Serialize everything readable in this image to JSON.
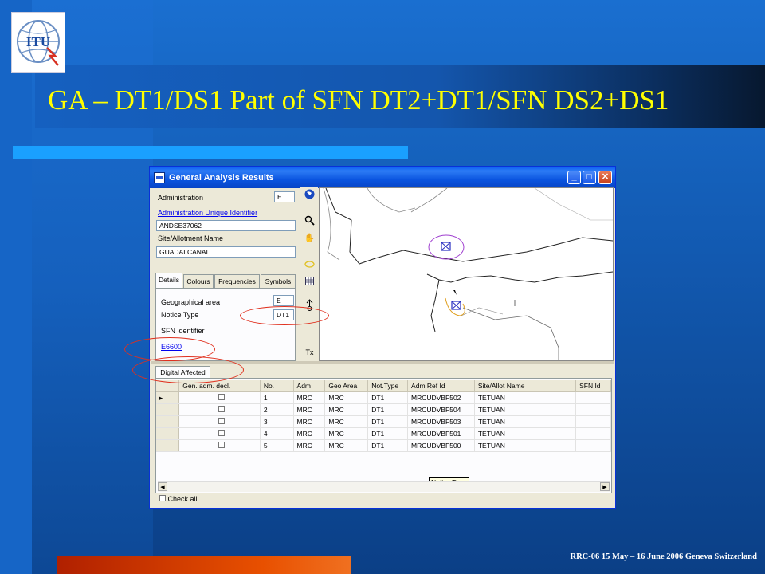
{
  "slide": {
    "title": "GA – DT1/DS1 Part of SFN DT2+DT1/SFN DS2+DS1",
    "footer": "RRC-06 15 May – 16 June 2006 Geneva Switzerland",
    "logo_text": "ITU",
    "colors": {
      "title": "#ffff00",
      "background": "#1259b0",
      "accent_line": "#1aa0ff",
      "bottom_bar": "#e85000"
    }
  },
  "window": {
    "title": "General Analysis Results",
    "fields": {
      "administration_label": "Administration",
      "administration_value": "E",
      "admin_uid_link": "Administration Unique Identifier",
      "admin_uid_value": "ANDSE37062",
      "site_label": "Site/Allotment Name",
      "site_value": "GUADALCANAL"
    },
    "tabs": [
      "Details",
      "Colours",
      "Frequencies",
      "Symbols"
    ],
    "details": {
      "geo_label": "Geographical area",
      "geo_value": "E",
      "notice_label": "Notice Type",
      "notice_value": "DT1",
      "sfn_label": "SFN identifier",
      "sfn_link": "E6600"
    },
    "tools": [
      "globe-icon",
      "zoom-icon",
      "hand-icon",
      "ellipse-icon",
      "grid-icon",
      "arrow-icon"
    ],
    "tool_tx": "Tx",
    "lower_tab": "Digital Affected",
    "grid": {
      "columns": [
        "Gen. adm. decl.",
        "No.",
        "Adm",
        "Geo Area",
        "Not.Type",
        "Adm Ref Id",
        "Site/Allot Name",
        "SFN Id"
      ],
      "rows": [
        [
          "1",
          "MRC",
          "MRC",
          "DT1",
          "MRCUDVBF502",
          "TETUAN"
        ],
        [
          "2",
          "MRC",
          "MRC",
          "DT1",
          "MRCUDVBF504",
          "TETUAN"
        ],
        [
          "3",
          "MRC",
          "MRC",
          "DT1",
          "MRCUDVBF503",
          "TETUAN"
        ],
        [
          "4",
          "MRC",
          "MRC",
          "DT1",
          "MRCUDVBF501",
          "TETUAN"
        ],
        [
          "5",
          "MRC",
          "MRC",
          "DT1",
          "MRCUDVBF500",
          "TETUAN"
        ]
      ]
    },
    "tooltip": "Notice Type",
    "check_all": "Check all"
  }
}
